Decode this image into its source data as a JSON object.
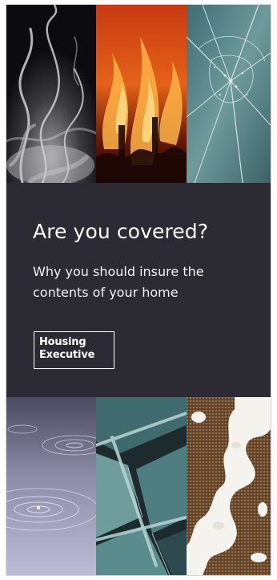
{
  "leaflet": {
    "title": "Are you covered?",
    "subtitle": "Why you should insure the contents of your home",
    "logo": {
      "line1": "Housing",
      "line2": "Executive"
    }
  },
  "images": {
    "top": [
      "smoke",
      "fire",
      "cracked-glass"
    ],
    "bottom": [
      "water-ripples",
      "broken-glass-panes",
      "carpet-spill"
    ]
  },
  "colors": {
    "band": "#2c2b34",
    "text": "#ffffff"
  }
}
